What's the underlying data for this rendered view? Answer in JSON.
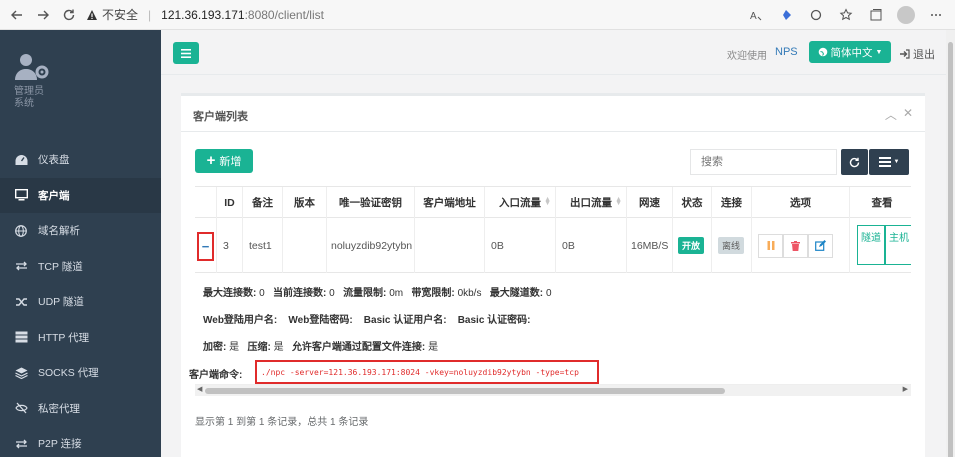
{
  "browser": {
    "security_warning": "不安全",
    "url_host": "121.36.193.171",
    "url_path": ":8080/client/list"
  },
  "sidebar": {
    "profile_name_line1": "管理员",
    "profile_name_line2": "系统",
    "items": [
      {
        "label": "仪表盘",
        "icon": "dashboard-icon"
      },
      {
        "label": "客户端",
        "icon": "monitor-icon"
      },
      {
        "label": "域名解析",
        "icon": "globe-icon"
      },
      {
        "label": "TCP 隧道",
        "icon": "tcp-tunnel-icon"
      },
      {
        "label": "UDP 隧道",
        "icon": "shuffle-icon"
      },
      {
        "label": "HTTP 代理",
        "icon": "server-icon"
      },
      {
        "label": "SOCKS 代理",
        "icon": "layers-icon"
      },
      {
        "label": "私密代理",
        "icon": "eye-slash-icon"
      },
      {
        "label": "P2P 连接",
        "icon": "exchange-icon"
      }
    ],
    "active_index": 1
  },
  "header": {
    "welcome": "欢迎使用",
    "brand": "NPS",
    "language": "简体中文",
    "logout": "退出"
  },
  "panel": {
    "title": "客户端列表",
    "add_label": "新增",
    "search_placeholder": "搜索"
  },
  "table": {
    "columns": [
      "ID",
      "备注",
      "版本",
      "唯一验证密钥",
      "客户端地址",
      "入口流量",
      "出口流量",
      "网速",
      "状态",
      "连接",
      "选项",
      "查看"
    ],
    "rows": [
      {
        "id": "3",
        "remark": "test1",
        "version": "",
        "vkey": "noluyzdib92ytybn",
        "address": "",
        "in_flow": "0B",
        "out_flow": "0B",
        "speed": "16MB/S",
        "status": "开放",
        "connection": "离线",
        "view_tunnel": "隧道",
        "view_host": "主机"
      }
    ]
  },
  "detail": {
    "line1": {
      "max_conn_label": "最大连接数:",
      "max_conn": "0",
      "cur_conn_label": "当前连接数:",
      "cur_conn": "0",
      "flow_limit_label": "流量限制:",
      "flow_limit": "0m",
      "rate_limit_label": "带宽限制:",
      "rate_limit": "0kb/s",
      "max_tunnel_label": "最大隧道数:",
      "max_tunnel": "0"
    },
    "line2": {
      "web_user_label": "Web登陆用户名:",
      "web_pass_label": "Web登陆密码:",
      "basic_user_label": "Basic 认证用户名:",
      "basic_pass_label": "Basic 认证密码:"
    },
    "line3": {
      "encrypt_label": "加密:",
      "encrypt": "是",
      "compress_label": "压缩:",
      "compress": "是",
      "config_conn_label": "允许客户端通过配置文件连接:",
      "config_conn": "是"
    },
    "command_label": "客户端命令:",
    "command": "./npc -server=121.36.193.171:8024 -vkey=noluyzdib92ytybn -type=tcp"
  },
  "footer": {
    "summary": "显示第 1 到第 1 条记录，总共 1 条记录"
  },
  "colors": {
    "accent": "#1ab394",
    "sidebar": "#2f4050",
    "highlight_border": "#e02b2b",
    "link": "#337ab7"
  }
}
